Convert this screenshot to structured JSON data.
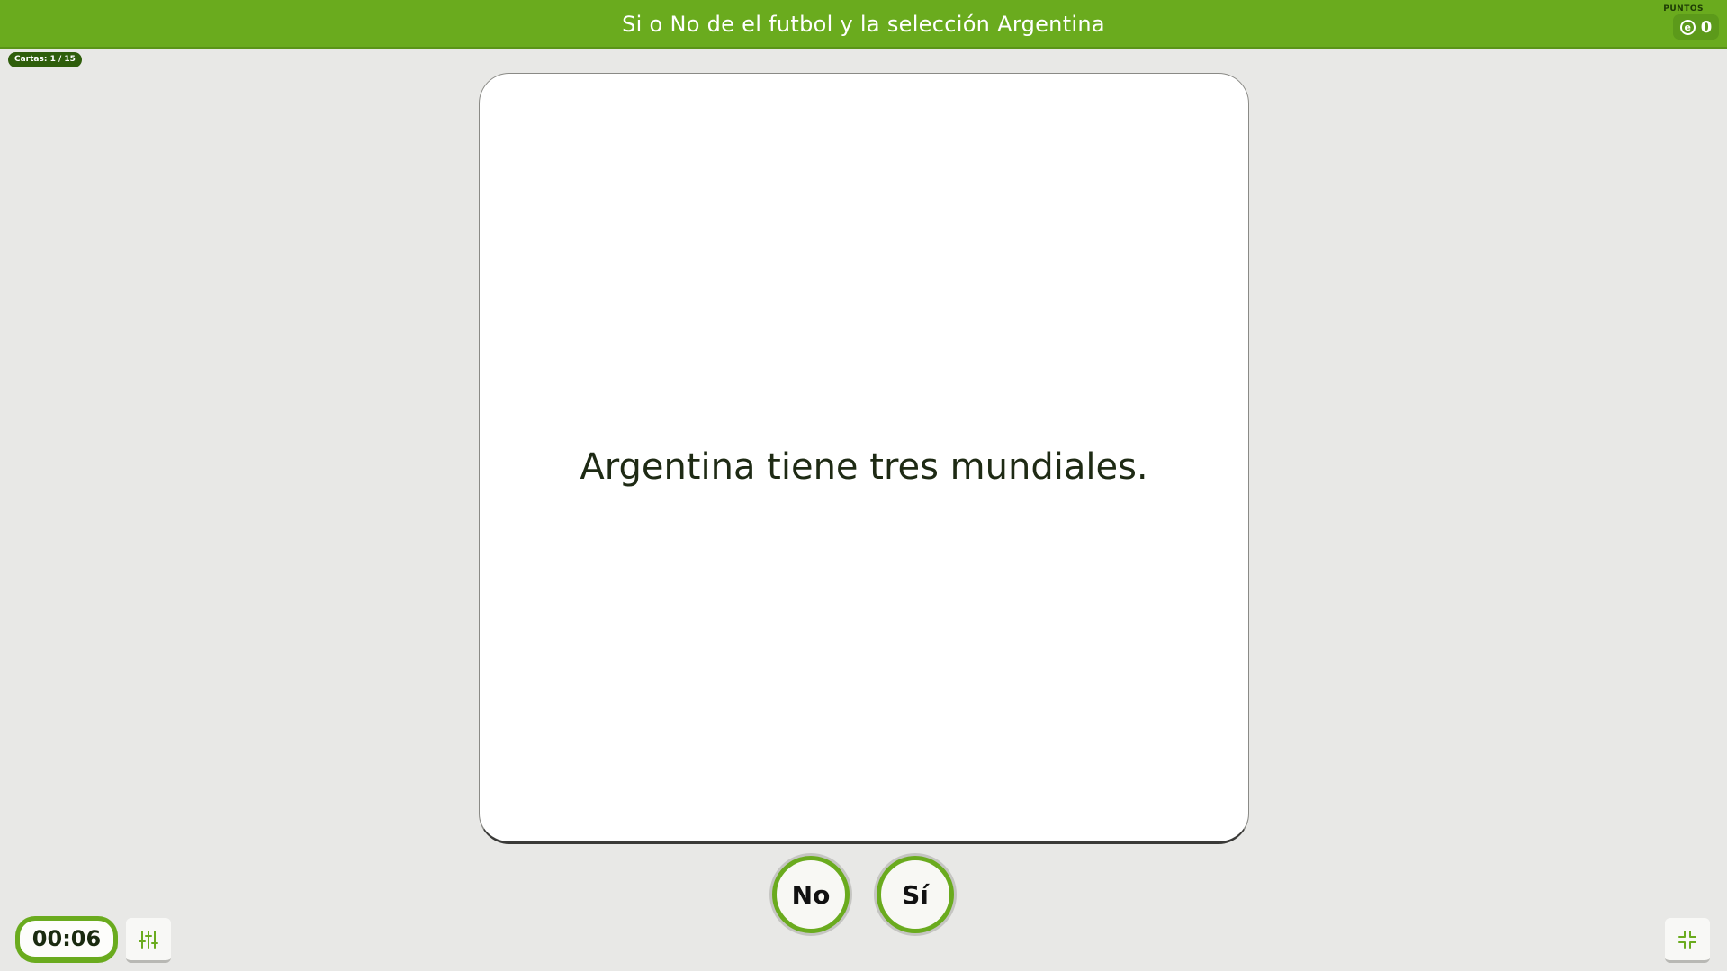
{
  "header": {
    "title": "Si o No de el futbol y la selección Argentina",
    "score_label": "PUNTOS",
    "score_value": "0",
    "coin_glyph": "e"
  },
  "progress": {
    "label": "Cartas: 1 / 15"
  },
  "card": {
    "text": "Argentina tiene tres mundiales."
  },
  "answers": {
    "no_label": "No",
    "si_label": "Sí"
  },
  "timer": {
    "value": "00:06"
  },
  "icons": {
    "settings": "sliders-icon",
    "fullscreen": "exit-fullscreen-icon",
    "coin": "coin-icon"
  },
  "colors": {
    "accent": "#6aab1e",
    "counter_bg": "#2f5e0c",
    "background": "#e8e8e6"
  }
}
